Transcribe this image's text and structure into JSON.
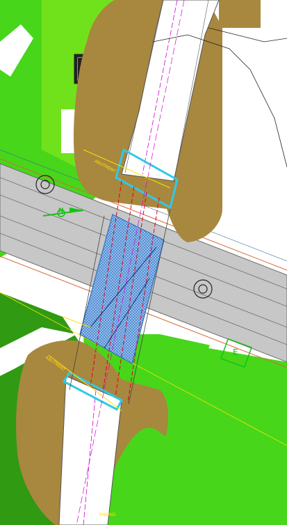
{
  "colors": {
    "grass": "#47d61a",
    "grass_light": "#70e21c",
    "grass_dark": "#2f9a12",
    "embankment": "#a8873f",
    "road": "#c7c7c7",
    "road_edge": "#6c6c6c",
    "deck_hatch": "#2f6fc0",
    "deck_fill": "#9cc4ef",
    "centerline": "#d400d4",
    "grid_red": "#e0001a",
    "leader_yellow": "#ffe000",
    "cyan_edge": "#31c9e6",
    "annotation_green": "#14c214"
  },
  "annotations": {
    "north_arrow_label": "N",
    "chainage_box": "E",
    "label_upper": "ABUTMENT",
    "label_lower": "ABUTMENT",
    "label_bottom": "ENDING"
  },
  "icons": {
    "manhole_left": "circle-target-icon",
    "manhole_right": "circle-target-icon",
    "north_arrow": "north-arrow-icon"
  }
}
